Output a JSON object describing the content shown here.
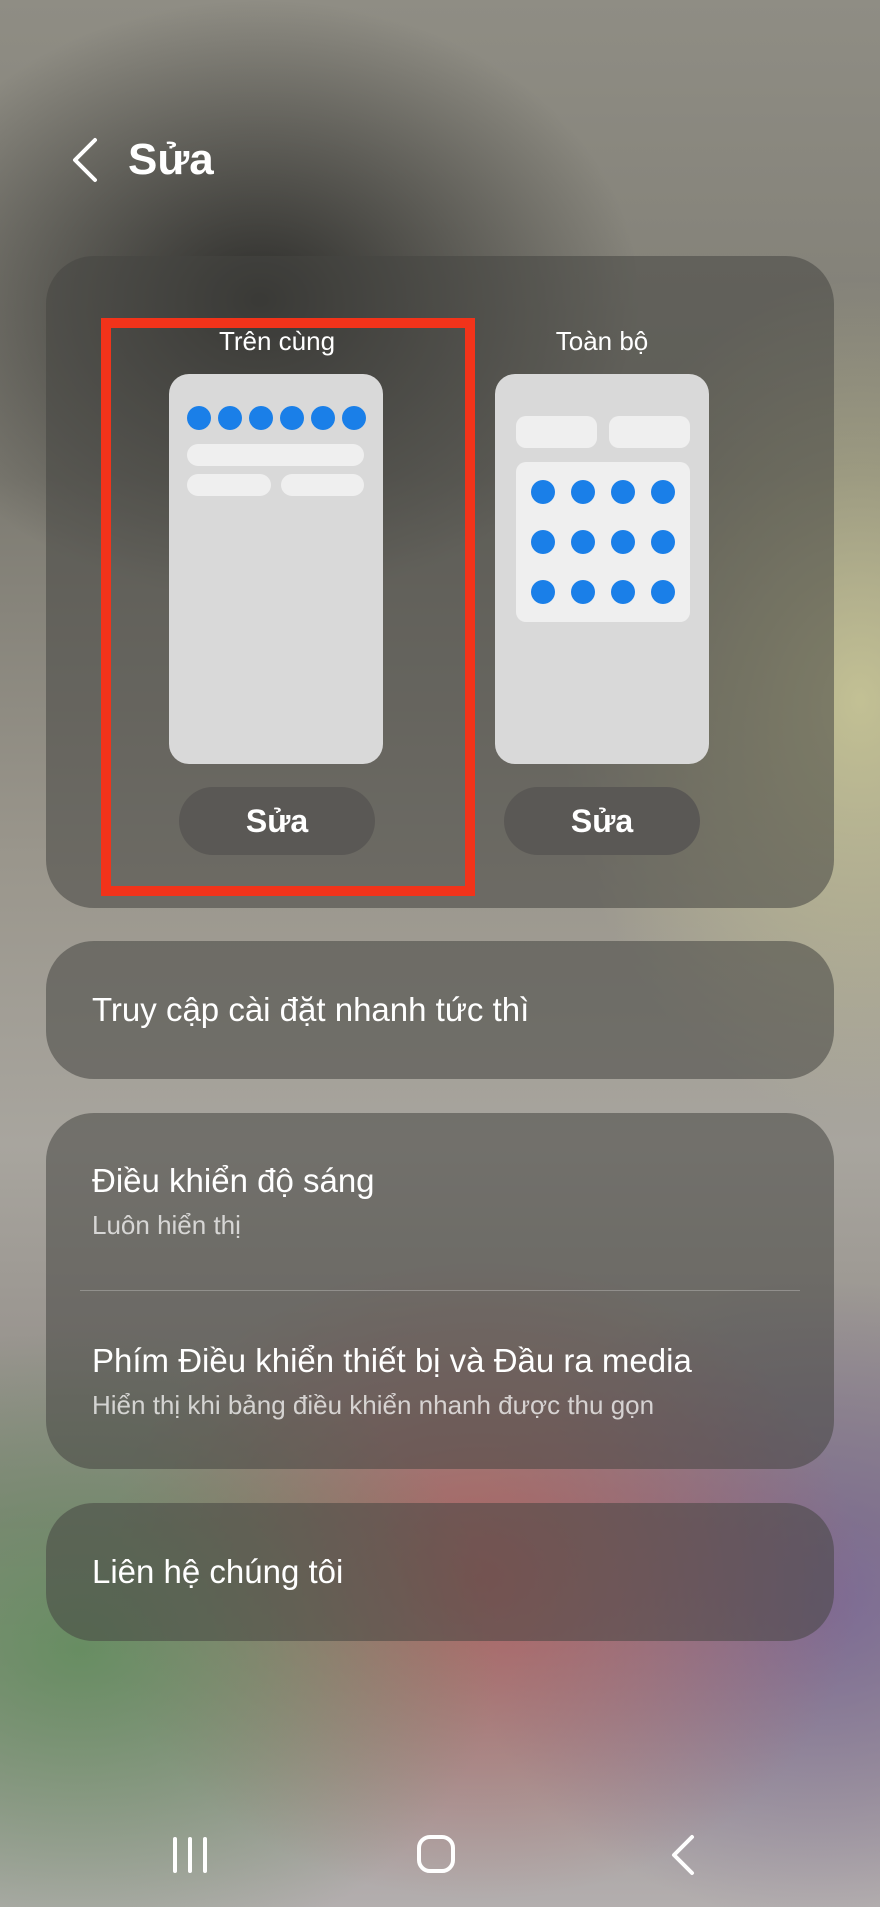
{
  "header": {
    "title": "Sửa",
    "back_icon": "chevron-left-icon"
  },
  "layout_options": [
    {
      "label": "Trên cùng",
      "button": "Sửa",
      "selected": true
    },
    {
      "label": "Toàn bộ",
      "button": "Sửa",
      "selected": false
    }
  ],
  "settings": {
    "instant_access": {
      "title": "Truy cập cài đặt nhanh tức thì"
    },
    "brightness": {
      "title": "Điều khiển độ sáng",
      "subtitle": "Luôn hiển thị"
    },
    "device_media": {
      "title": "Phím Điều khiển thiết bị và Đầu ra media",
      "subtitle": "Hiển thị khi bảng điều khiển nhanh được thu gọn"
    },
    "contact": {
      "title": "Liên hệ chúng tôi"
    }
  },
  "navbar": {
    "recents_icon": "recents-icon",
    "home_icon": "home-icon",
    "back_icon": "back-icon"
  },
  "colors": {
    "highlight": "#f2331a",
    "accent_dot": "#1a7fe8"
  }
}
